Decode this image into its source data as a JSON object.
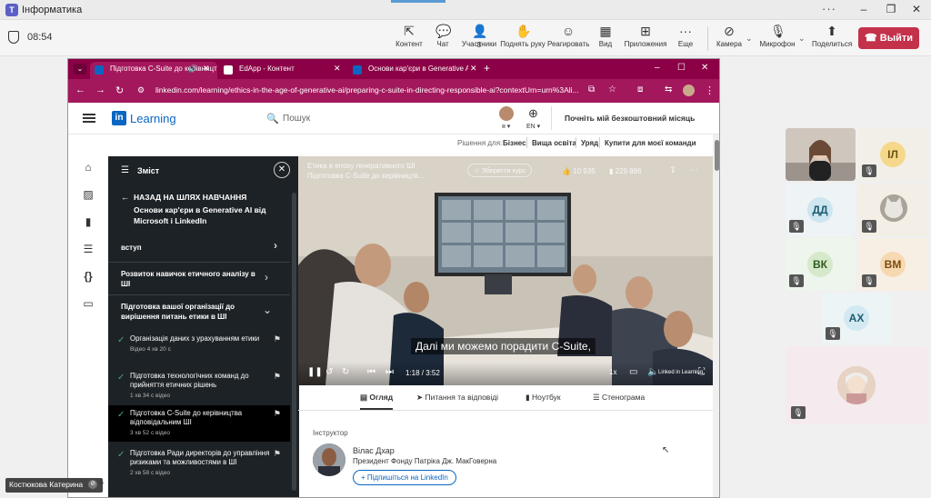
{
  "teams": {
    "title": "Інформатика",
    "timer": "08:54",
    "toolbar": [
      {
        "label": "Контент",
        "icon": "share-content-icon"
      },
      {
        "label": "Чат",
        "icon": "chat-icon"
      },
      {
        "label": "Участники",
        "icon": "people-icon",
        "badge": "8"
      },
      {
        "label": "Поднять руку",
        "icon": "raise-hand-icon"
      },
      {
        "label": "Реагировать",
        "icon": "react-icon"
      },
      {
        "label": "Вид",
        "icon": "view-icon"
      },
      {
        "label": "Приложения",
        "icon": "apps-icon"
      },
      {
        "label": "Еще",
        "icon": "more-icon"
      },
      {
        "label": "Камера",
        "icon": "camera-icon"
      },
      {
        "label": "Микрофон",
        "icon": "microphone-icon"
      },
      {
        "label": "Поделиться",
        "icon": "share-icon"
      }
    ],
    "leave_label": "Выйти",
    "participants": [
      {
        "initials": "ІЛ",
        "color": "#f5d88a"
      },
      {
        "initials": "ДД",
        "color": "#cde6ef"
      },
      {
        "initials": "ВК",
        "color": "#d6eacb"
      },
      {
        "initials": "ВМ",
        "color": "#f6d9b0"
      },
      {
        "initials": "АХ",
        "color": "#d2e9f2"
      }
    ],
    "bottom_name": "Костюкова Катерина"
  },
  "browser": {
    "tabs": [
      {
        "title": "Підготовка C-Suite до керівництва"
      },
      {
        "title": "EdApp - Контент"
      },
      {
        "title": "Основи кар'єри в Generative AI"
      }
    ],
    "url": "linkedin.com/learning/ethics-in-the-age-of-generative-ai/preparing-c-suite-in-directing-responsible-ai?contextUrn=urn%3Ali..."
  },
  "linkedin": {
    "logo_text": "Learning",
    "search_placeholder": "Пошук",
    "me_label": "я",
    "lang_label": "EN",
    "trial_label": "Почніть мій безкоштовний місяць",
    "solutions_label": "Рішення для:",
    "solutions": [
      "Бізнес",
      "Вища освіта",
      "Уряд",
      "Купити для моєї команди"
    ],
    "toc": {
      "title": "Зміст",
      "back": "НАЗАД НА ШЛЯХ НАВЧАННЯ",
      "path_title": "Основи кар'єри в Generative AI від Microsoft і LinkedIn",
      "sections": [
        "вступ",
        "Розвиток навичок етичного аналізу в ШІ",
        "Підготовка вашої організації до вирішення питань етики в ШІ"
      ],
      "lessons": [
        {
          "title": "Організація даних з урахуванням етики",
          "meta": "Відео 4 хв 20 с"
        },
        {
          "title": "Підготовка технологічних команд до прийняття етичних рішень",
          "meta": "1 хв 34 с відео"
        },
        {
          "title": "Підготовка C-Suite до керівництва відповідальним ШІ",
          "meta": "3 хв 52 с відео"
        },
        {
          "title": "Підготовка Ради директорів до управління ризиками та можливостями в ШІ",
          "meta": "2 хв 58 с відео"
        }
      ]
    },
    "video": {
      "overlay_title": "Етика в епоху генеративного ШІ",
      "overlay_sub": "Підготовка C-Suite до керівництв...",
      "save_label": "Зберегти курс",
      "likes": "10 935",
      "views": "229 886",
      "subtitle": "Далі ми можемо порадити C-Suite,",
      "time": "1:18 / 3:52",
      "speed": "1x",
      "brand": "Linked in Learning"
    },
    "content_tabs": [
      "Огляд",
      "Питання та відповіді",
      "Ноутбук",
      "Стенограма"
    ],
    "instructor": {
      "heading": "Інструктор",
      "name": "Вілас Дхар",
      "role": "Президент Фонду Патріка Дж. МакГоверна",
      "follow": "Підпишіться на LinkedIn"
    }
  }
}
